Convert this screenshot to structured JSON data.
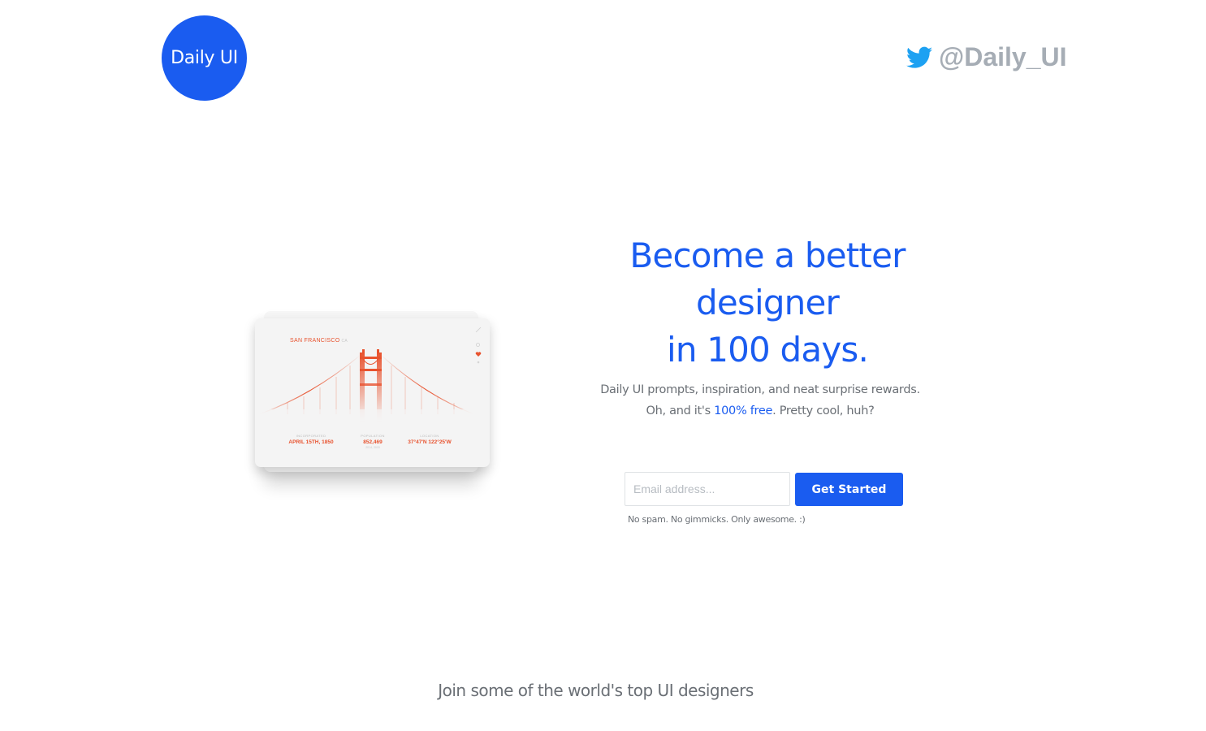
{
  "header": {
    "logo_text": "Daily UI",
    "twitter_handle": "@Daily_UI"
  },
  "hero": {
    "headline_line1": "Become a better designer",
    "headline_line2": "in 100 days.",
    "sub_line1": "Daily UI prompts, inspiration, and neat surprise rewards.",
    "sub_line2_prefix": "Oh, and it's ",
    "sub_line2_link": "100% free",
    "sub_line2_suffix": ".  Pretty cool, huh?"
  },
  "signup": {
    "email_placeholder": "Email address...",
    "email_value": "",
    "button_label": "Get Started",
    "fine_print": "No spam.  No gimmicks.  Only awesome. :)"
  },
  "mockup": {
    "city": "SAN FRANCISCO",
    "state": "CA",
    "stats": [
      {
        "label": "INCORPORATED",
        "value": "APRIL 15TH, 1850",
        "sub": ""
      },
      {
        "label": "POPULATION",
        "value": "852,469",
        "sub": "2014, 2015"
      },
      {
        "label": "LOCATION",
        "value": "37°47'N 122°25'W",
        "sub": ""
      }
    ]
  },
  "footer": {
    "join_text": "Join some of the world's top UI designers"
  },
  "colors": {
    "brand_blue": "#1a5cf0",
    "twitter_blue": "#1da1f2",
    "handle_gray": "#a6adb5",
    "bridge_orange": "#e8532f",
    "body_text": "#6a6f75"
  },
  "icons": {
    "twitter": "twitter-bird-icon",
    "expand": "expand-icon",
    "search": "search-icon",
    "heart": "heart-icon",
    "share": "share-icon"
  }
}
